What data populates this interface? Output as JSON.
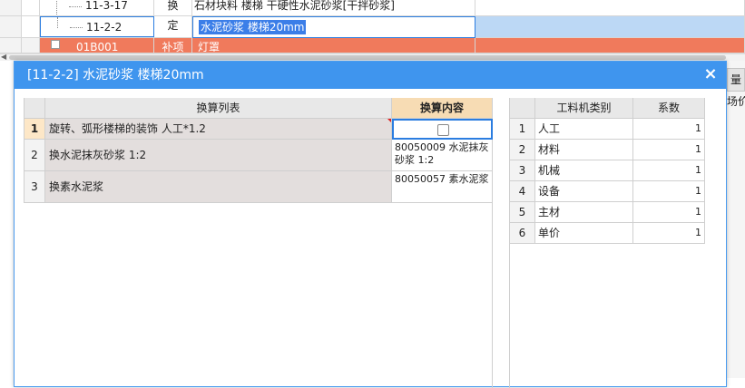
{
  "background": {
    "rows": [
      {
        "code": "11-3-17",
        "type": "换",
        "name": "石材块料 楼梯 干硬性水泥砂浆[干拌砂浆]"
      },
      {
        "code": "11-2-2",
        "type": "定",
        "name": "水泥砂浆 楼梯20mm"
      },
      {
        "code": "01B001",
        "type": "补项",
        "name": "灯罩"
      }
    ],
    "right_button": "量",
    "right_label": "场价"
  },
  "dialog": {
    "title": "[11-2-2] 水泥砂浆 楼梯20mm",
    "close": "×",
    "left_table": {
      "headers": [
        "换算列表",
        "换算内容"
      ],
      "rows": [
        {
          "num": "1",
          "name": "旋转、弧形楼梯的装饰 人工*1.2",
          "content": ""
        },
        {
          "num": "2",
          "name": "换水泥抹灰砂浆 1:2",
          "content": "80050009  水泥抹灰砂浆 1:2"
        },
        {
          "num": "3",
          "name": "换素水泥浆",
          "content": "80050057  素水泥浆"
        }
      ]
    },
    "right_table": {
      "headers": [
        "工料机类别",
        "系数"
      ],
      "rows": [
        {
          "num": "1",
          "type": "人工",
          "coef": "1"
        },
        {
          "num": "2",
          "type": "材料",
          "coef": "1"
        },
        {
          "num": "3",
          "type": "机械",
          "coef": "1"
        },
        {
          "num": "4",
          "type": "设备",
          "coef": "1"
        },
        {
          "num": "5",
          "type": "主材",
          "coef": "1"
        },
        {
          "num": "6",
          "type": "单价",
          "coef": "1"
        }
      ]
    }
  },
  "colors": {
    "accent": "#3f95ee",
    "header_orange": "#f7dcb4",
    "red_row": "#f07a5c"
  }
}
